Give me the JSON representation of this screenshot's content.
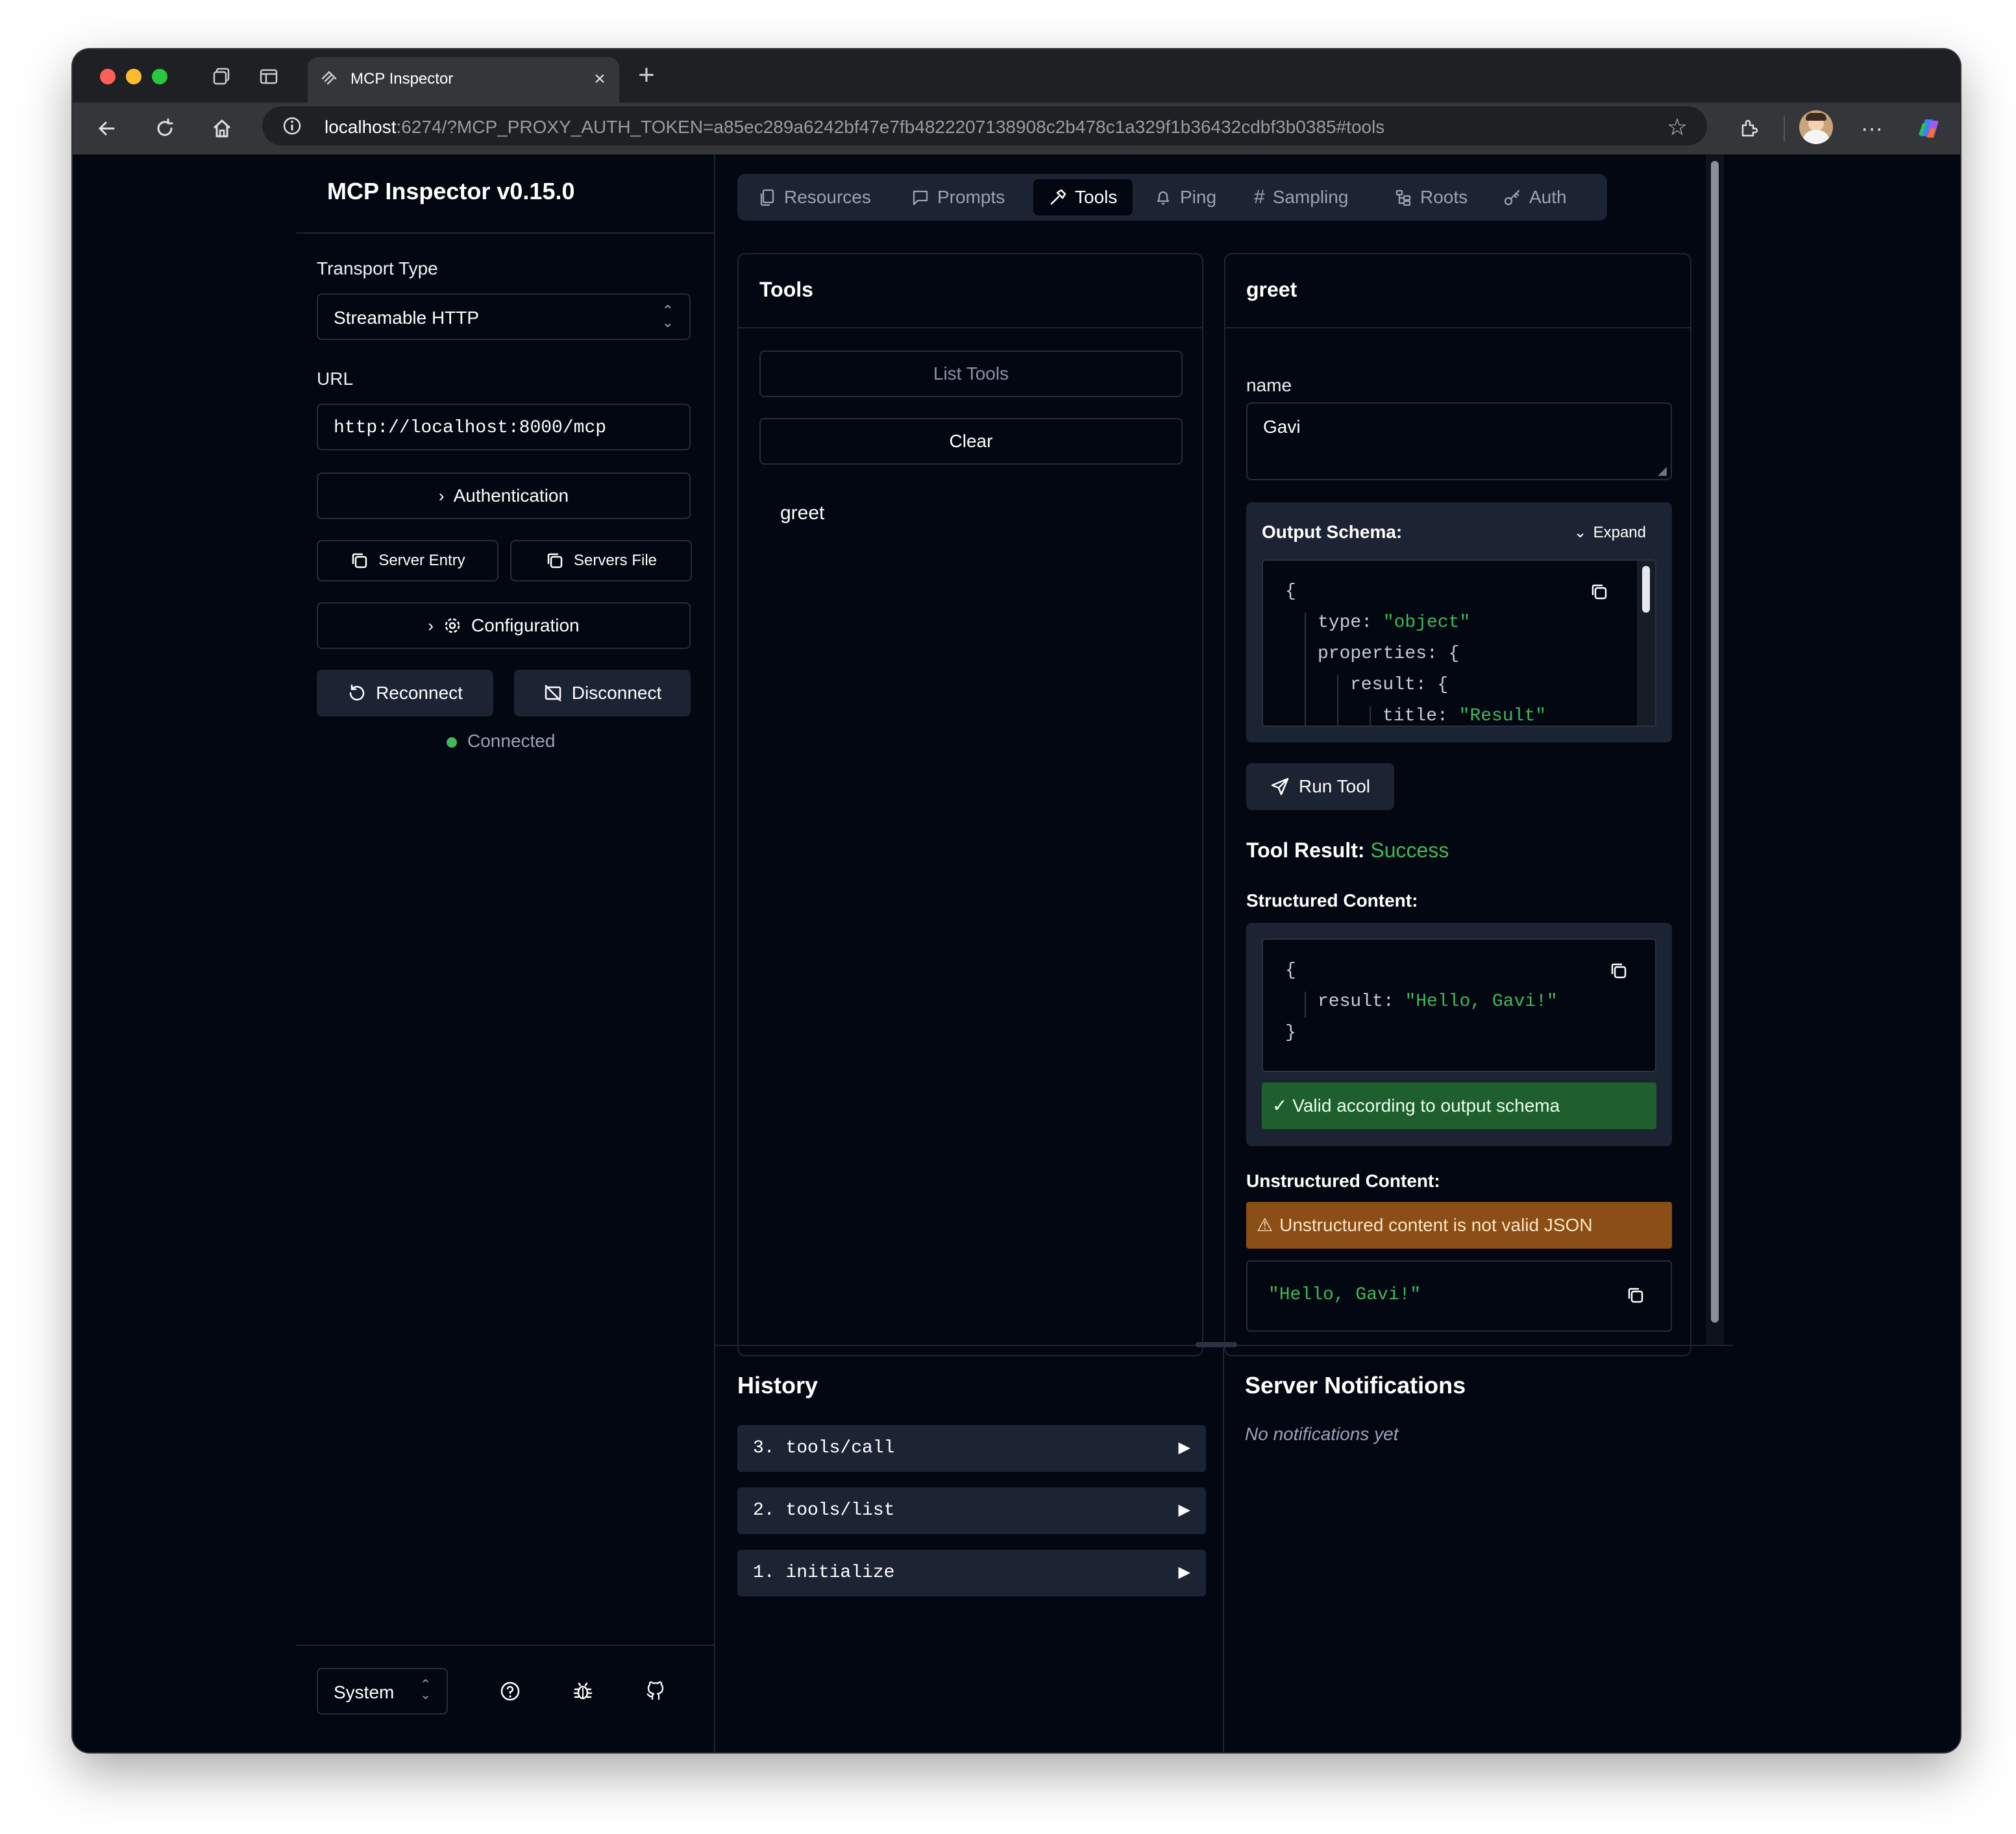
{
  "browser": {
    "tab_title": "MCP Inspector",
    "url_host": "localhost",
    "url_rest": ":6274/?MCP_PROXY_AUTH_TOKEN=a85ec289a6242bf47e7fb4822207138908c2b478c1a329f1b36432cdbf3b0385#tools",
    "traffic_colors": [
      "#ff5f57",
      "#febc2e",
      "#28c840"
    ]
  },
  "sidebar": {
    "title": "MCP Inspector v0.15.0",
    "transport_label": "Transport Type",
    "transport_value": "Streamable HTTP",
    "url_label": "URL",
    "url_value": "http://localhost:8000/mcp",
    "authentication": "Authentication",
    "server_entry": "Server Entry",
    "servers_file": "Servers File",
    "configuration": "Configuration",
    "reconnect": "Reconnect",
    "disconnect": "Disconnect",
    "status": "Connected",
    "status_color": "#3fb95a",
    "theme": "System"
  },
  "tabs": [
    "Resources",
    "Prompts",
    "Tools",
    "Ping",
    "Sampling",
    "Roots",
    "Auth"
  ],
  "active_tab": "Tools",
  "tools_panel": {
    "title": "Tools",
    "list_tools": "List Tools",
    "clear": "Clear",
    "items": [
      "greet"
    ]
  },
  "tool_detail": {
    "title": "greet",
    "param_label": "name",
    "param_value": "Gavi",
    "output_schema_label": "Output Schema:",
    "expand_label": "Expand",
    "schema_lines": {
      "open": "{",
      "type_key": "type:",
      "type_val": "\"object\"",
      "props_key": "properties: {",
      "result_key": "result: {",
      "title_key": "title:",
      "title_val": "\"Result\""
    },
    "run_tool": "Run Tool",
    "result_label": "Tool Result:",
    "result_status": "Success",
    "structured_label": "Structured Content:",
    "structured_open": "{",
    "structured_key": "result:",
    "structured_val": "\"Hello, Gavi!\"",
    "structured_close": "}",
    "valid_message": "✓ Valid according to output schema",
    "unstructured_label": "Unstructured Content:",
    "warning_message": "Unstructured content is not valid JSON",
    "unstructured_value": "\"Hello, Gavi!\""
  },
  "history": {
    "title": "History",
    "items": [
      "3.  tools/call",
      "2.  tools/list",
      "1.  initialize"
    ]
  },
  "notifications": {
    "title": "Server Notifications",
    "empty": "No notifications yet"
  }
}
